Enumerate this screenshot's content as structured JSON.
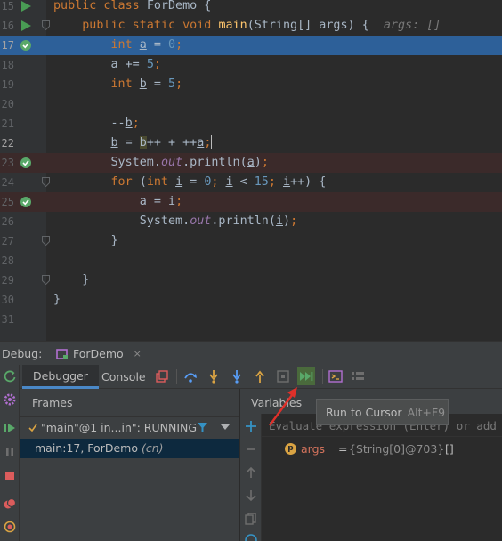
{
  "editor": {
    "lines": [
      {
        "num": "15",
        "segments": [
          [
            "kw",
            "public class "
          ],
          [
            "plain",
            "ForDemo {"
          ]
        ]
      },
      {
        "num": "16",
        "segments": [
          [
            "plain",
            "    "
          ],
          [
            "kw",
            "public static void "
          ],
          [
            "fn",
            "main"
          ],
          [
            "plain",
            "(String[] args) {  "
          ],
          [
            "hint",
            "args: []"
          ]
        ]
      },
      {
        "num": "17",
        "segments": [
          [
            "plain",
            "        "
          ],
          [
            "kw",
            "int "
          ],
          [
            "ul",
            "a"
          ],
          [
            "plain",
            " = "
          ],
          [
            "num",
            "0"
          ],
          [
            "kw",
            ";"
          ]
        ]
      },
      {
        "num": "18",
        "segments": [
          [
            "plain",
            "        "
          ],
          [
            "ul",
            "a"
          ],
          [
            "plain",
            " += "
          ],
          [
            "num",
            "5"
          ],
          [
            "kw",
            ";"
          ]
        ]
      },
      {
        "num": "19",
        "segments": [
          [
            "plain",
            "        "
          ],
          [
            "kw",
            "int "
          ],
          [
            "ul",
            "b"
          ],
          [
            "plain",
            " = "
          ],
          [
            "num",
            "5"
          ],
          [
            "kw",
            ";"
          ]
        ]
      },
      {
        "num": "20",
        "segments": []
      },
      {
        "num": "21",
        "segments": [
          [
            "plain",
            "        --"
          ],
          [
            "ul",
            "b"
          ],
          [
            "kw",
            ";"
          ]
        ]
      },
      {
        "num": "22",
        "segments": [
          [
            "plain",
            "        "
          ],
          [
            "ul",
            "b"
          ],
          [
            "plain",
            " = "
          ],
          [
            "hl",
            "b"
          ],
          [
            "plain",
            "++ + ++"
          ],
          [
            "ul",
            "a"
          ],
          [
            "kw",
            ";"
          ]
        ]
      },
      {
        "num": "23",
        "segments": [
          [
            "plain",
            "        System."
          ],
          [
            "st",
            "out"
          ],
          [
            "plain",
            ".println("
          ],
          [
            "ul",
            "a"
          ],
          [
            "plain",
            ")"
          ],
          [
            "kw",
            ";"
          ]
        ]
      },
      {
        "num": "24",
        "segments": [
          [
            "plain",
            "        "
          ],
          [
            "kw",
            "for "
          ],
          [
            "plain",
            "("
          ],
          [
            "kw",
            "int "
          ],
          [
            "ul",
            "i"
          ],
          [
            "plain",
            " = "
          ],
          [
            "num",
            "0"
          ],
          [
            "kw",
            "; "
          ],
          [
            "ul",
            "i"
          ],
          [
            "plain",
            " < "
          ],
          [
            "num",
            "15"
          ],
          [
            "kw",
            "; "
          ],
          [
            "ul",
            "i"
          ],
          [
            "plain",
            "++) {"
          ]
        ]
      },
      {
        "num": "25",
        "segments": [
          [
            "plain",
            "            "
          ],
          [
            "ul",
            "a"
          ],
          [
            "plain",
            " = "
          ],
          [
            "ul",
            "i"
          ],
          [
            "kw",
            ";"
          ]
        ]
      },
      {
        "num": "26",
        "segments": [
          [
            "plain",
            "            System."
          ],
          [
            "st",
            "out"
          ],
          [
            "plain",
            ".println("
          ],
          [
            "ul",
            "i"
          ],
          [
            "plain",
            ")"
          ],
          [
            "kw",
            ";"
          ]
        ]
      },
      {
        "num": "27",
        "segments": [
          [
            "plain",
            "        }"
          ]
        ]
      },
      {
        "num": "28",
        "segments": []
      },
      {
        "num": "29",
        "segments": [
          [
            "plain",
            "    }"
          ]
        ]
      },
      {
        "num": "30",
        "segments": [
          [
            "plain",
            "}"
          ]
        ]
      },
      {
        "num": "31",
        "segments": []
      }
    ]
  },
  "debug": {
    "label": "Debug:",
    "run_config_tab": "ForDemo",
    "tab_close": "×",
    "tabs": {
      "debugger": "Debugger",
      "console": "Console"
    },
    "frames_header": "Frames",
    "thread": "\"main\"@1 in...in\": RUNNING",
    "frame": {
      "location": "main:17, ForDemo",
      "package": "(cn)"
    },
    "variables_header": "Variables",
    "eval_placeholder": "Evaluate expression (Enter) or add a watch",
    "variable": {
      "badge": "p",
      "name": "args",
      "eq": "=",
      "value": "{String[0]@703}",
      "array": "[]"
    }
  },
  "tooltip": {
    "text": "Run to Cursor",
    "shortcut": "Alt+F9"
  },
  "colors": {
    "accent": "#4a88c7",
    "current_line": "#2d6099",
    "breakpoint_line": "#3b2a2a",
    "arrow": "#e0302a",
    "run_green": "#499c54"
  }
}
